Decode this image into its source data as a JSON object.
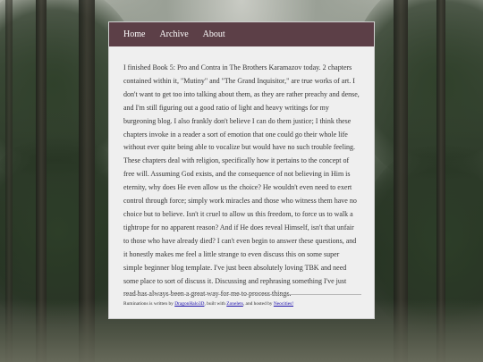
{
  "nav": {
    "home": "Home",
    "archive": "Archive",
    "about": "About"
  },
  "post": {
    "body": "I finished Book 5: Pro and Contra in The Brothers Karamazov today. 2 chapters contained within it, \"Mutiny\" and \"The Grand Inquisitor,\" are true works of art. I don't want to get too into talking about them, as they are rather preachy and dense, and I'm still figuring out a good ratio of light and heavy writings for my burgeoning blog. I also frankly don't believe I can do them justice; I think these chapters invoke in a reader a sort of emotion that one could go their whole life without ever quite being able to vocalize but would have no such trouble feeling. These chapters deal with religion, specifically how it pertains to the concept of free will. Assuming God exists, and the consequence of not believing in Him is eternity, why does He even allow us the choice? He wouldn't even need to exert control through force; simply work miracles and those who witness them have no choice but to believe. Isn't it cruel to allow us this freedom, to force us to walk a tightrope for no apparent reason? And if He does reveal Himself, isn't that unfair to those who have already died? I can't even begin to answer these questions, and it honestly makes me feel a little strange to even discuss this on some super simple beginner blog template. I've just been absolutely loving TBK and need some place to sort of discuss it. Discussing and rephrasing something I've just read has always been a great way for me to process things."
  },
  "footer": {
    "prefix": "Ruminations is written by ",
    "author": "DragonHalo3D",
    "middle1": ", built with ",
    "builder": "Zonelets",
    "middle2": ", and hosted by ",
    "host": "Neocities!"
  }
}
